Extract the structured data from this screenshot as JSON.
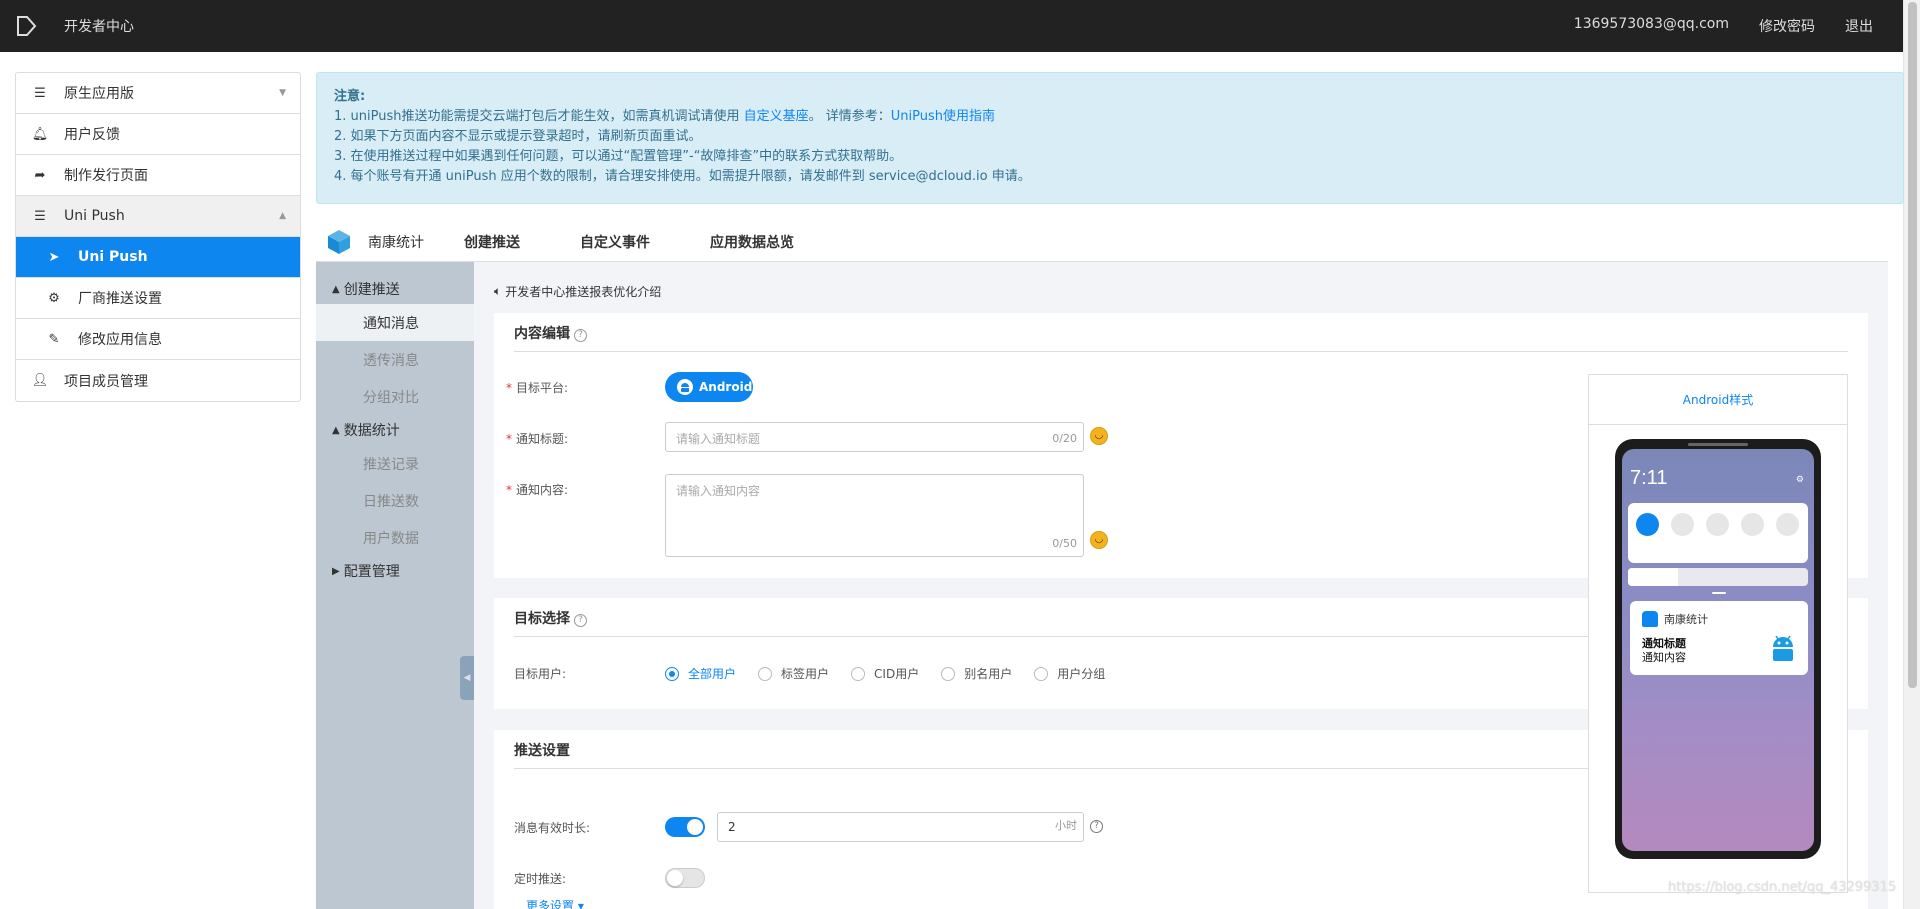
{
  "topbar": {
    "title": "开发者中心",
    "email": "1369573083@qq.com",
    "change_password": "修改密码",
    "logout": "退出"
  },
  "sidebar": {
    "items": [
      {
        "label": "原生应用版",
        "icon": "list-icon"
      },
      {
        "label": "用户反馈",
        "icon": "bell-icon"
      },
      {
        "label": "制作发行页面",
        "icon": "share-icon"
      },
      {
        "label": "Uni Push",
        "icon": "list-icon"
      },
      {
        "label": "Uni Push",
        "icon": "send-icon"
      },
      {
        "label": "厂商推送设置",
        "icon": "gear-icon"
      },
      {
        "label": "修改应用信息",
        "icon": "edit-icon"
      },
      {
        "label": "项目成员管理",
        "icon": "user-icon"
      }
    ]
  },
  "notice": {
    "head": "注意:",
    "line1_a": "1. uniPush推送功能需提交云端打包后才能生效，如需真机调试请使用",
    "line1_link1": "自定义基座",
    "line1_b": "。 详情参考：",
    "line1_link2": "UniPush使用指南",
    "line2": "2. 如果下方页面内容不显示或提示登录超时，请刷新页面重试。",
    "line3": "3. 在使用推送过程中如果遇到任何问题，可以通过“配置管理”-“故障排查”中的联系方式获取帮助。",
    "line4": "4. 每个账号有开通 uniPush 应用个数的限制，请合理安排使用。如需提升限额，请发邮件到 service@dcloud.io 申请。"
  },
  "apptabs": {
    "app_name": "南康统计",
    "tabs": [
      "创建推送",
      "自定义事件",
      "应用数据总览"
    ]
  },
  "leftnav": {
    "sections": [
      {
        "label": "创建推送",
        "items": [
          "通知消息",
          "透传消息",
          "分组对比"
        ]
      },
      {
        "label": "数据统计",
        "items": [
          "推送记录",
          "日推送数",
          "用户数据"
        ]
      },
      {
        "label": "配置管理",
        "items": []
      }
    ],
    "active_item": "通知消息"
  },
  "main": {
    "intro": "开发者中心推送报表优化介绍",
    "content_card": {
      "title": "内容编辑",
      "platform_label": "目标平台:",
      "platform_button": "Android",
      "title_label": "通知标题:",
      "title_placeholder": "请输入通知标题",
      "title_count": "0/20",
      "content_label": "通知内容:",
      "content_placeholder": "请输入通知内容",
      "content_count": "0/50"
    },
    "target_card": {
      "title": "目标选择",
      "users_label": "目标用户:",
      "options": [
        "全部用户",
        "标签用户",
        "CID用户",
        "别名用户",
        "用户分组"
      ],
      "selected": "全部用户"
    },
    "push_card": {
      "title": "推送设置",
      "valid_label": "消息有效时长:",
      "valid_value": "2",
      "valid_unit": "小时",
      "valid_toggle_on": true,
      "schedule_label": "定时推送:",
      "schedule_toggle_on": false,
      "more_settings": "更多设置"
    }
  },
  "preview": {
    "title": "Android样式",
    "time": "7:11",
    "app_name": "南康统计",
    "notif_title": "通知标题",
    "notif_content": "通知内容"
  },
  "watermark": "https://blog.csdn.net/qq_43299315",
  "colors": {
    "accent": "#0d86f0",
    "topbar": "#222222",
    "notice_bg": "#d9edf7",
    "leftnav_bg": "#bdc7d1"
  }
}
